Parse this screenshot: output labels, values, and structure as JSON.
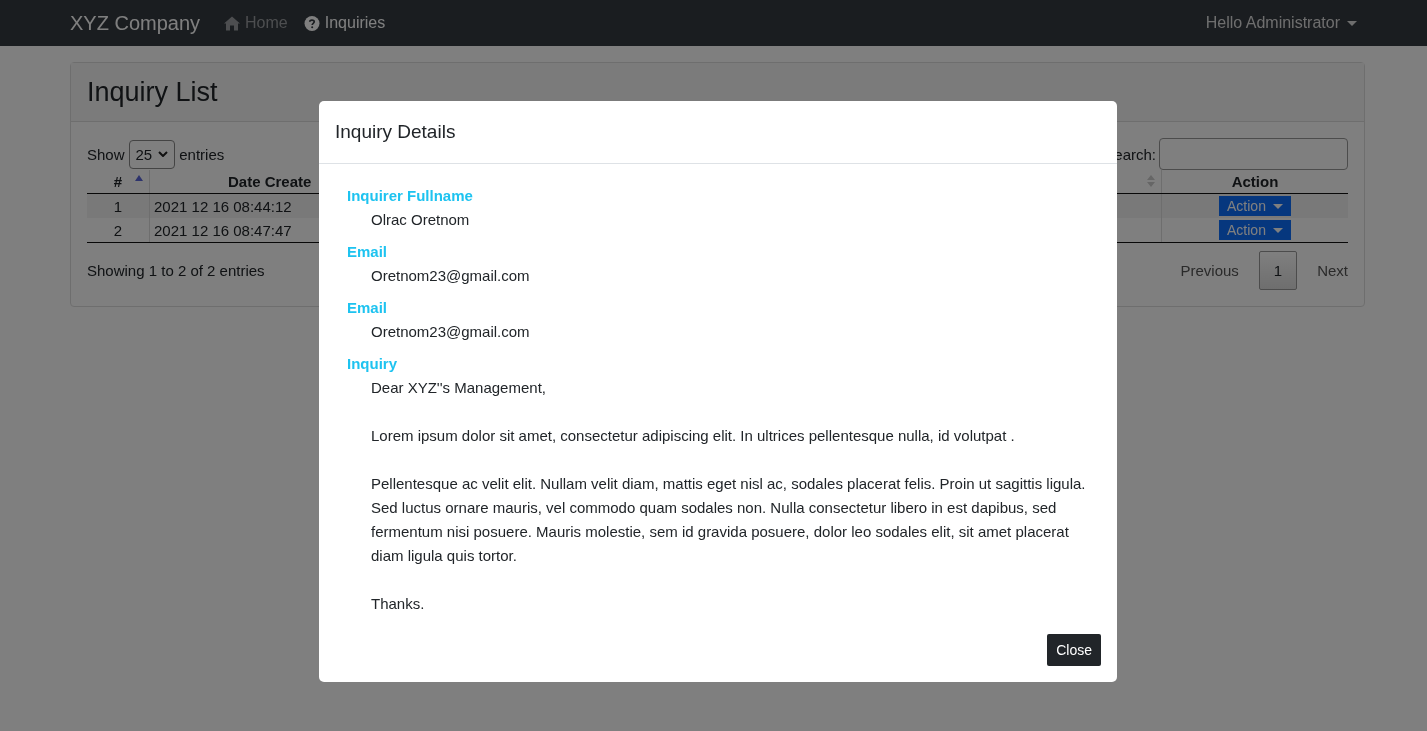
{
  "navbar": {
    "brand": "XYZ Company",
    "links": [
      {
        "label": "Home",
        "kind": "home",
        "selected": false
      },
      {
        "label": "Inquiries",
        "kind": "help",
        "selected": true
      }
    ],
    "user": "Hello Administrator"
  },
  "card": {
    "title": "Inquiry List",
    "show_label": "Show",
    "length": "25",
    "entries_label": "entries",
    "search_label": "earch:",
    "columns": [
      {
        "label": "#",
        "kind": "sorted"
      },
      {
        "label": "Date Create",
        "kind": "sortable"
      },
      {
        "label": "Action",
        "kind": "plain"
      }
    ],
    "rows": [
      {
        "number": "1",
        "date": "2021 12 16 08:44:12",
        "action": "Action"
      },
      {
        "number": "2",
        "date": "2021 12 16 08:47:47",
        "action": "Action"
      }
    ],
    "info": "Showing 1 to 2 of 2 entries",
    "pagination": {
      "previous": "Previous",
      "pages": [
        {
          "label": "1",
          "selected": true
        }
      ],
      "next": "Next"
    }
  },
  "modal": {
    "title": "Inquiry Details",
    "fields": [
      {
        "label": "Inquirer Fullname",
        "value": "Olrac Oretnom"
      },
      {
        "label": "Email",
        "value": "Oretnom23@gmail.com"
      },
      {
        "label": "Email",
        "value": "Oretnom23@gmail.com"
      }
    ],
    "inquiry": {
      "label": "Inquiry",
      "paragraphs": [
        "Dear XYZ''s Management,",
        "Lorem ipsum dolor sit amet, consectetur adipiscing elit. In ultrices pellentesque nulla, id volutpat .",
        "Pellentesque ac velit elit. Nullam velit diam, mattis eget nisl ac, sodales placerat felis. Proin ut sagittis ligula. Sed luctus ornare mauris, vel commodo quam sodales non. Nulla consectetur libero in est dapibus, sed fermentum nisi posuere. Mauris molestie, sem id gravida posuere, dolor leo sodales elit, sit amet placerat diam ligula quis tortor.",
        "Thanks."
      ]
    },
    "close": "Close"
  }
}
